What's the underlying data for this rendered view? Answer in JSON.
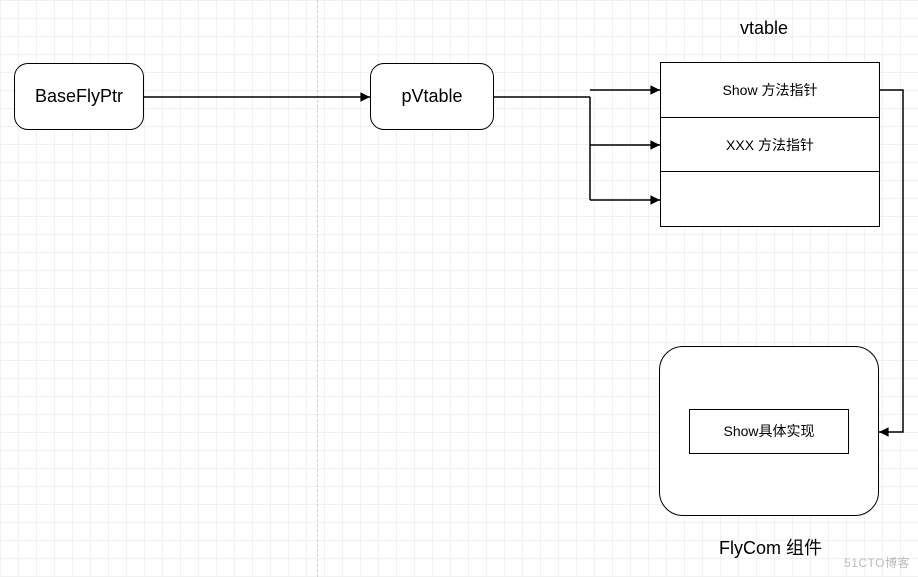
{
  "diagram": {
    "basePtr": "BaseFlyPtr",
    "pvtable": "pVtable",
    "vtable_title": "vtable",
    "vtable_rows": {
      "r0": "Show 方法指针",
      "r1": "XXX 方法指针",
      "r2": ""
    },
    "flycom_title": "FlyCom 组件",
    "show_impl": "Show具体实现"
  },
  "watermark": "51CTO博客"
}
